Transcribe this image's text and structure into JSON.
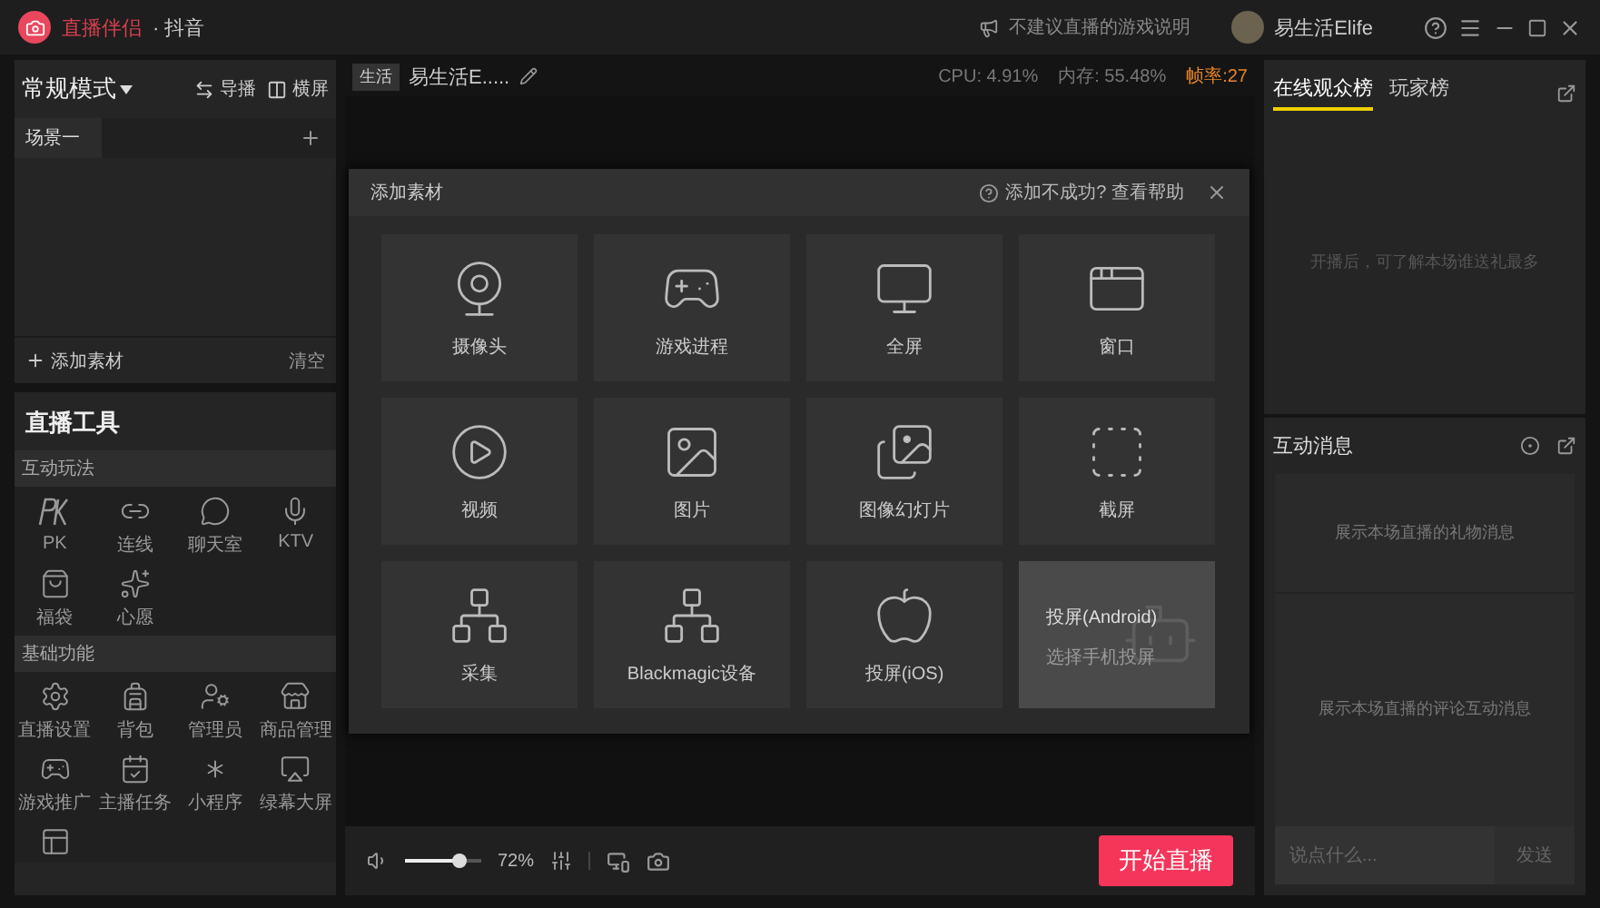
{
  "titlebar": {
    "app_name": "直播伴侣",
    "platform": "· 抖音",
    "notice": "不建议直播的游戏说明",
    "user_name": "易生活Elife"
  },
  "scene_panel": {
    "mode": "常规模式",
    "actions": [
      {
        "label": "导播"
      },
      {
        "label": "横屏"
      }
    ],
    "scenes": [
      {
        "label": "场景一",
        "selected": true
      }
    ],
    "add_label": "添加素材",
    "clear_label": "清空"
  },
  "tools": {
    "title": "直播工具",
    "sections": [
      {
        "title": "互动玩法",
        "items": [
          {
            "label": "PK"
          },
          {
            "label": "连线"
          },
          {
            "label": "聊天室"
          },
          {
            "label": "KTV"
          },
          {
            "label": "福袋"
          },
          {
            "label": "心愿"
          }
        ]
      },
      {
        "title": "基础功能",
        "items": [
          {
            "label": "直播设置"
          },
          {
            "label": "背包"
          },
          {
            "label": "管理员"
          },
          {
            "label": "商品管理"
          },
          {
            "label": "游戏推广"
          },
          {
            "label": "主播任务"
          },
          {
            "label": "小程序"
          },
          {
            "label": "绿幕大屏"
          }
        ]
      }
    ]
  },
  "stream_info": {
    "category": "生活",
    "title": "易生活E.....",
    "cpu": "CPU: 4.91%",
    "memory": "内存: 55.48%",
    "fps": "帧率:27"
  },
  "dialog": {
    "title": "添加素材",
    "help": "添加不成功? 查看帮助",
    "tiles": [
      {
        "label": "摄像头",
        "selected": false
      },
      {
        "label": "游戏进程",
        "selected": false
      },
      {
        "label": "全屏",
        "selected": false
      },
      {
        "label": "窗口",
        "selected": false
      },
      {
        "label": "视频",
        "selected": false
      },
      {
        "label": "图片",
        "selected": false
      },
      {
        "label": "图像幻灯片",
        "selected": false
      },
      {
        "label": "截屏",
        "selected": false
      },
      {
        "label": "采集",
        "selected": false
      },
      {
        "label": "Blackmagic设备",
        "selected": false
      },
      {
        "label": "投屏(iOS)",
        "selected": false
      },
      {
        "label": "投屏(Android)",
        "subtitle": "选择手机投屏",
        "selected": true
      }
    ]
  },
  "bottom_bar": {
    "volume": {
      "level": 0.72
    },
    "volume_reading": "72%",
    "start_button": "开始直播"
  },
  "ranking": {
    "tabs": [
      {
        "label": "在线观众榜",
        "selected": true
      },
      {
        "label": "玩家榜",
        "selected": false
      }
    ],
    "empty_text": "开播后，可了解本场谁送礼最多"
  },
  "messages": {
    "title": "互动消息",
    "gift_text": "展示本场直播的礼物消息",
    "comment_text": "展示本场直播的评论互动消息",
    "input": {
      "placeholder": "说点什么..."
    },
    "send_button": "发送"
  }
}
